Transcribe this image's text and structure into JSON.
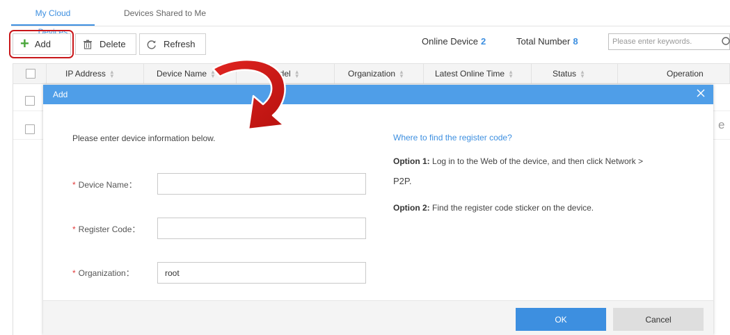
{
  "tabs": [
    {
      "label": "My Cloud Devices",
      "active": true
    },
    {
      "label": "Devices Shared to Me",
      "active": false
    }
  ],
  "toolbar": {
    "add_label": "Add",
    "delete_label": "Delete",
    "refresh_label": "Refresh",
    "online_label": "Online Device",
    "online_count": "2",
    "total_label": "Total Number",
    "total_count": "8",
    "search_placeholder": "Please enter keywords."
  },
  "table": {
    "columns": [
      "IP Address",
      "Device Name",
      "Model",
      "Organization",
      "Latest Online Time",
      "Status",
      "Operation"
    ]
  },
  "background_glyph": "e",
  "modal": {
    "title": "Add",
    "intro": "Please enter device information below.",
    "fields": [
      {
        "label": "Device Name：",
        "value": ""
      },
      {
        "label": "Register Code：",
        "value": ""
      },
      {
        "label": "Organization：",
        "value": "root"
      }
    ],
    "help_link": "Where to find the register code?",
    "option1_label": "Option 1:",
    "option1_text": "Log in to the Web of the device, and then click Network >",
    "option1_cont": "P2P.",
    "option2_label": "Option 2:",
    "option2_text": "Find the register code sticker on the device.",
    "ok_label": "OK",
    "cancel_label": "Cancel"
  },
  "colors": {
    "accent": "#3d8fe0",
    "modal_header": "#4f9ee8",
    "highlight": "#c9171a",
    "add_icon": "#4aa63b",
    "required": "#e23b3b"
  },
  "icons": [
    "plus-icon",
    "trash-icon",
    "refresh-icon",
    "search-icon",
    "sort-icon",
    "close-icon",
    "curved-arrow-icon"
  ]
}
